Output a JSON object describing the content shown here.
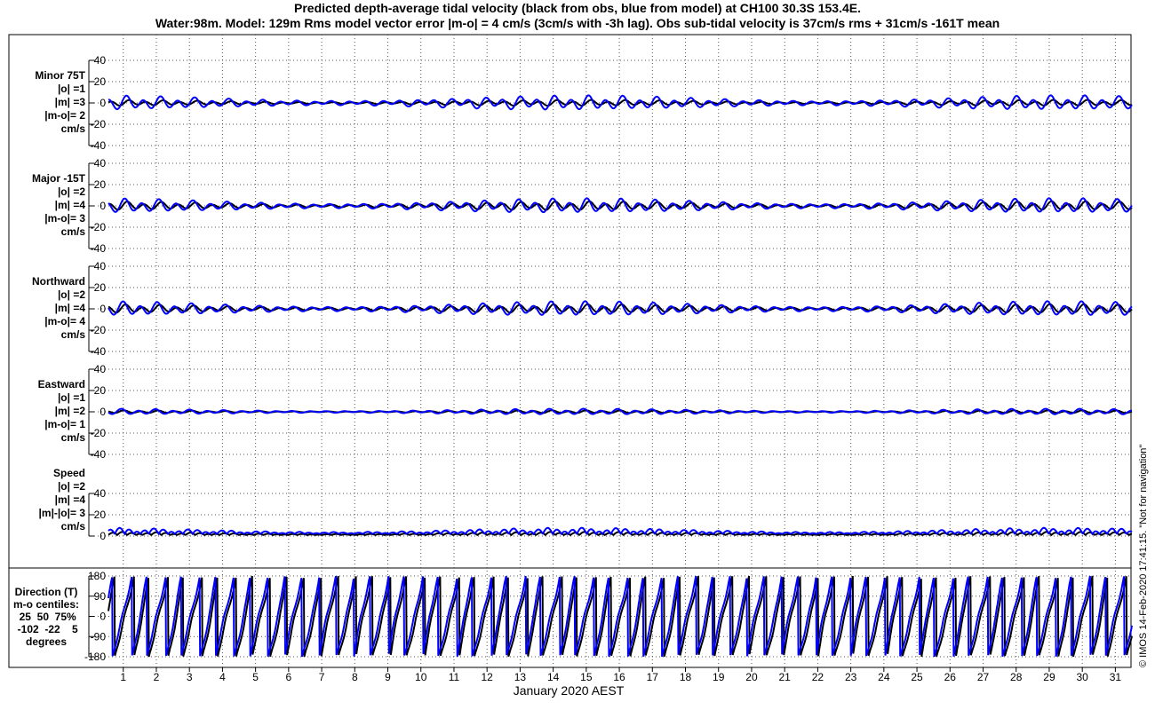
{
  "title": {
    "line1": "Predicted depth-average tidal velocity (black from obs, blue from model) at CH100 30.3S 153.4E.",
    "line2": "Water:98m. Model: 129m  Rms model vector error |m-o| = 4 cm/s (3cm/s with -3h lag). Obs sub-tidal velocity is 37cm/s rms + 31cm/s -161T mean"
  },
  "copyright": "© IMOS 14-Feb-2020 17:41:15.  \"Not for navigation\"",
  "colors": {
    "obs": "#000000",
    "model": "#0000ff",
    "grid": "#555555",
    "axis": "#000000"
  },
  "chart_data": {
    "type": "line",
    "xlabel": "January 2020 AEST",
    "x_ticks": [
      "1",
      "2",
      "3",
      "4",
      "5",
      "6",
      "7",
      "8",
      "9",
      "10",
      "11",
      "12",
      "13",
      "14",
      "15",
      "16",
      "17",
      "18",
      "19",
      "20",
      "21",
      "22",
      "23",
      "24",
      "25",
      "26",
      "27",
      "28",
      "29",
      "30",
      "31"
    ],
    "xlim_days": [
      0.55,
      31.5
    ],
    "series_legend": {
      "obs": "black from obs",
      "model": "blue from model"
    },
    "panels": [
      {
        "id": "minor",
        "label_lines": [
          "Minor 75T",
          "|o| =1",
          "|m| =3",
          "|m-o|= 2",
          "cm/s"
        ],
        "ylim": [
          -40,
          40
        ],
        "yticks": [
          "40",
          "20",
          "0",
          "-20",
          "-40"
        ],
        "obs_amp": 2,
        "model_amp": 5
      },
      {
        "id": "major",
        "label_lines": [
          "Major -15T",
          "|o| =2",
          "|m| =4",
          "|m-o|= 3",
          "cm/s"
        ],
        "ylim": [
          -40,
          40
        ],
        "yticks": [
          "40",
          "20",
          "0",
          "-20",
          "-40"
        ],
        "obs_amp": 3,
        "model_amp": 5
      },
      {
        "id": "northward",
        "label_lines": [
          "Northward",
          "|o| =2",
          "|m| =4",
          "|m-o|= 4",
          "cm/s"
        ],
        "ylim": [
          -40,
          40
        ],
        "yticks": [
          "40",
          "20",
          "0",
          "-20",
          "-40"
        ],
        "obs_amp": 3,
        "model_amp": 5
      },
      {
        "id": "eastward",
        "label_lines": [
          "Eastward",
          "|o| =1",
          "|m| =2",
          "|m-o|= 1",
          "cm/s"
        ],
        "ylim": [
          -40,
          40
        ],
        "yticks": [
          "40",
          "20",
          "0",
          "-20",
          "-40"
        ],
        "obs_amp": 1,
        "model_amp": 2
      },
      {
        "id": "speed",
        "label_lines": [
          "Speed",
          "|o| =2",
          "|m| =4",
          "|m|-|o|= 3",
          "cm/s"
        ],
        "ylim": [
          0,
          40
        ],
        "yticks": [
          "40",
          "20",
          "0"
        ],
        "obs_amp": 2,
        "model_amp": 4
      },
      {
        "id": "direction",
        "label_lines": [
          "Direction (T)",
          "m-o centiles:",
          " 25  50  75%",
          " -102  -22    5",
          "degrees"
        ],
        "ylim": [
          -180,
          180
        ],
        "yticks": [
          "180",
          "90",
          "0",
          "-90",
          "-180"
        ]
      }
    ]
  }
}
